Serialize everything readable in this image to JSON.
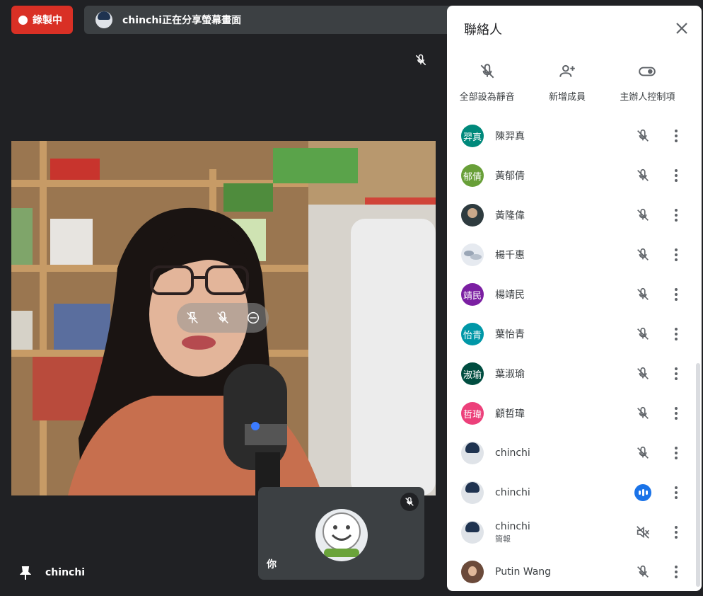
{
  "recording": {
    "label": "錄製中"
  },
  "banner": {
    "text": "chinchi正在分享螢幕畫面"
  },
  "self_tile": {
    "label": "你"
  },
  "pinned": {
    "name": "chinchi"
  },
  "panel": {
    "title": "聯絡人",
    "actions": [
      {
        "label": "全部設為靜音",
        "icon": "mute-all-icon"
      },
      {
        "label": "新增成員",
        "icon": "add-person-icon"
      },
      {
        "label": "主辦人控制項",
        "icon": "toggle-icon"
      }
    ],
    "participants": [
      {
        "initials": "羿真",
        "name": "陳羿真",
        "color": "#00897b",
        "avatar": "initials",
        "status": "muted"
      },
      {
        "initials": "郁倩",
        "name": "黃郁倩",
        "color": "#689f38",
        "avatar": "initials",
        "status": "muted"
      },
      {
        "initials": "",
        "name": "黃隆偉",
        "color": "#2e3b3f",
        "avatar": "dark",
        "status": "muted"
      },
      {
        "initials": "",
        "name": "楊千惠",
        "color": "#e6eaf0",
        "avatar": "clouds",
        "status": "muted"
      },
      {
        "initials": "靖民",
        "name": "楊靖民",
        "color": "#7b1fa2",
        "avatar": "initials",
        "status": "muted"
      },
      {
        "initials": "怡青",
        "name": "葉怡青",
        "color": "#0097a7",
        "avatar": "initials",
        "status": "muted"
      },
      {
        "initials": "淑瑜",
        "name": "葉淑瑜",
        "color": "#004d40",
        "avatar": "initials",
        "status": "muted"
      },
      {
        "initials": "哲瑋",
        "name": "顧哲瑋",
        "color": "#ec407a",
        "avatar": "initials",
        "status": "muted"
      },
      {
        "initials": "",
        "name": "chinchi",
        "color": "#dfe3e8",
        "avatar": "photo",
        "status": "muted"
      },
      {
        "initials": "",
        "name": "chinchi",
        "color": "#dfe3e8",
        "avatar": "photo",
        "status": "speaking"
      },
      {
        "initials": "",
        "name": "chinchi",
        "sub": "簡報",
        "color": "#dfe3e8",
        "avatar": "photo",
        "status": "audio-off"
      },
      {
        "initials": "",
        "name": "Putin Wang",
        "color": "#6b4a3a",
        "avatar": "woman",
        "status": "muted"
      }
    ]
  }
}
